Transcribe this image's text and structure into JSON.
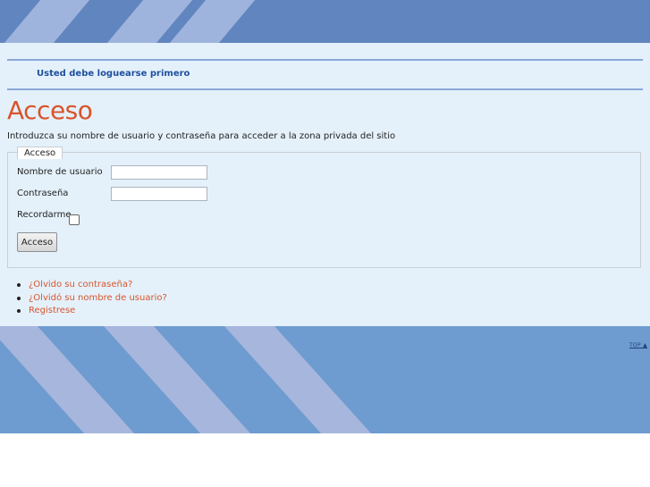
{
  "notice": "Usted debe loguearse primero",
  "page_title": "Acceso",
  "intro": "Introduzca su nombre de usuario y contraseña para acceder a la zona privada del sitio",
  "form": {
    "legend": "Acceso",
    "username_label": "Nombre de usuario",
    "username_value": "",
    "password_label": "Contraseña",
    "password_value": "",
    "remember_label": "Recordarme",
    "remember_checked": false,
    "submit_label": "Acceso"
  },
  "links": [
    {
      "label": "¿Olvido su contraseña?"
    },
    {
      "label": "¿Olvidó su nombre de usuario?"
    },
    {
      "label": "Registrese"
    }
  ],
  "footer": {
    "top_link": "TOP ▲"
  },
  "colors": {
    "band_blue": "#6185bf",
    "band_stripe": "#9fb4dd",
    "content_bg": "#e4f1fb",
    "title_orange": "#d9542b",
    "link_orange": "#d9542b",
    "notice_blue": "#1e4f9c"
  }
}
